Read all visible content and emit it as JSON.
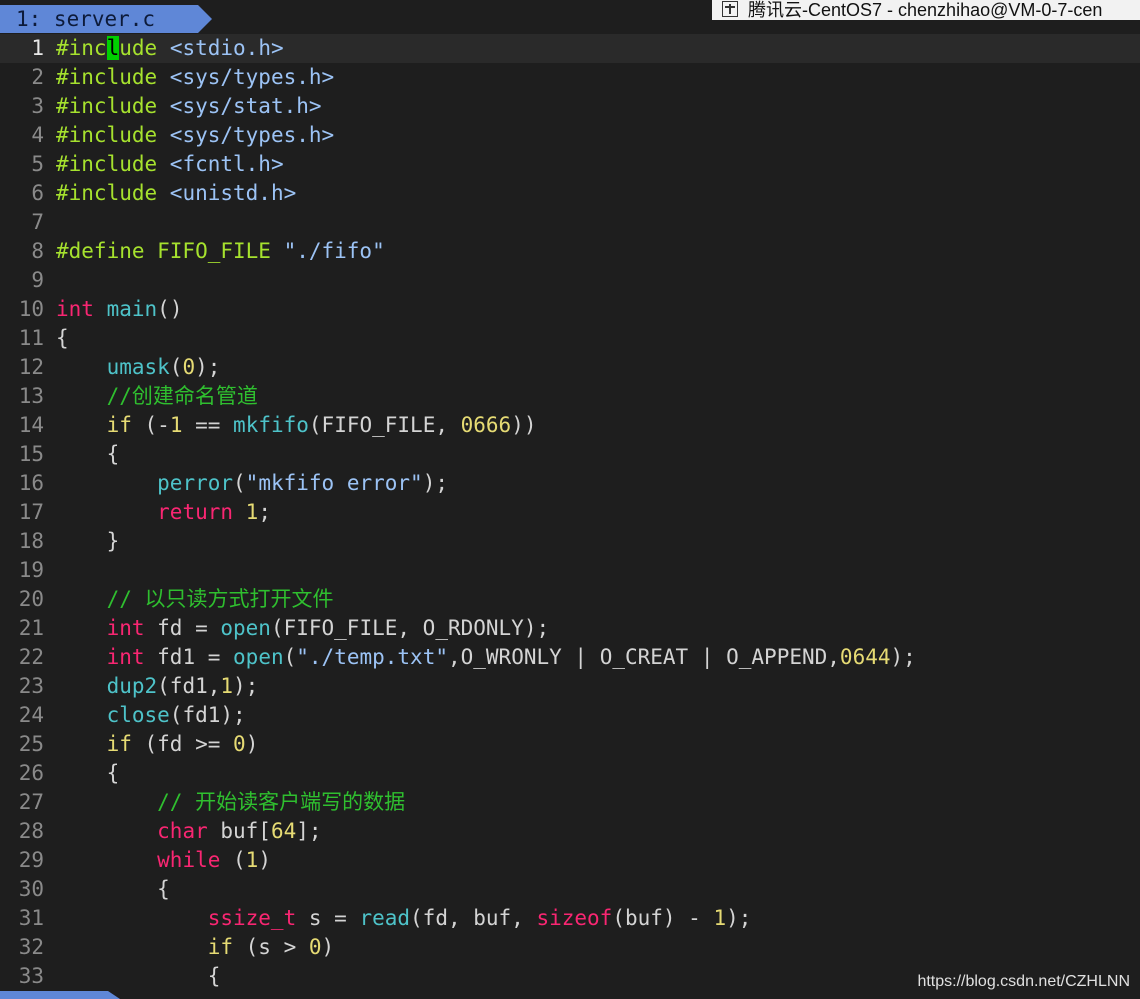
{
  "tab": {
    "label": "1: server.c"
  },
  "window_title": "腾讯云-CentOS7 - chenzhihao@VM-0-7-cen",
  "watermark": "https://blog.csdn.net/CZHLNN",
  "colors": {
    "tab": "#5f87d7",
    "cursor": "#00d000",
    "background": "#1e1e1e"
  },
  "cursor": {
    "line": 1,
    "column": 6
  },
  "lines": [
    {
      "n": "1",
      "tokens": [
        [
          "pp",
          "#inc"
        ],
        [
          "cursor",
          "l"
        ],
        [
          "pp",
          "ude "
        ],
        [
          "str",
          "<stdio.h>"
        ]
      ]
    },
    {
      "n": "2",
      "tokens": [
        [
          "pp",
          "#include "
        ],
        [
          "str",
          "<sys/types.h>"
        ]
      ]
    },
    {
      "n": "3",
      "tokens": [
        [
          "pp",
          "#include "
        ],
        [
          "str",
          "<sys/stat.h>"
        ]
      ]
    },
    {
      "n": "4",
      "tokens": [
        [
          "pp",
          "#include "
        ],
        [
          "str",
          "<sys/types.h>"
        ]
      ]
    },
    {
      "n": "5",
      "tokens": [
        [
          "pp",
          "#include "
        ],
        [
          "str",
          "<fcntl.h>"
        ]
      ]
    },
    {
      "n": "6",
      "tokens": [
        [
          "pp",
          "#include "
        ],
        [
          "str",
          "<unistd.h>"
        ]
      ]
    },
    {
      "n": "7",
      "tokens": []
    },
    {
      "n": "8",
      "tokens": [
        [
          "pp",
          "#define FIFO_FILE "
        ],
        [
          "str",
          "\"./fifo\""
        ]
      ]
    },
    {
      "n": "9",
      "tokens": []
    },
    {
      "n": "10",
      "tokens": [
        [
          "kw",
          "int"
        ],
        [
          "plain",
          " "
        ],
        [
          "fn",
          "main"
        ],
        [
          "plain",
          "()"
        ]
      ]
    },
    {
      "n": "11",
      "tokens": [
        [
          "plain",
          "{"
        ]
      ]
    },
    {
      "n": "12",
      "tokens": [
        [
          "plain",
          "    "
        ],
        [
          "fn",
          "umask"
        ],
        [
          "plain",
          "("
        ],
        [
          "num",
          "0"
        ],
        [
          "plain",
          ");"
        ]
      ]
    },
    {
      "n": "13",
      "tokens": [
        [
          "plain",
          "    "
        ],
        [
          "cm",
          "//创建命名管道"
        ]
      ]
    },
    {
      "n": "14",
      "tokens": [
        [
          "plain",
          "    "
        ],
        [
          "kw2",
          "if"
        ],
        [
          "plain",
          " (-"
        ],
        [
          "num",
          "1"
        ],
        [
          "plain",
          " == "
        ],
        [
          "fn",
          "mkfifo"
        ],
        [
          "plain",
          "(FIFO_FILE, "
        ],
        [
          "num",
          "0666"
        ],
        [
          "plain",
          "))"
        ]
      ]
    },
    {
      "n": "15",
      "tokens": [
        [
          "plain",
          "    {"
        ]
      ]
    },
    {
      "n": "16",
      "tokens": [
        [
          "plain",
          "        "
        ],
        [
          "fn",
          "perror"
        ],
        [
          "plain",
          "("
        ],
        [
          "str",
          "\"mkfifo error\""
        ],
        [
          "plain",
          ");"
        ]
      ]
    },
    {
      "n": "17",
      "tokens": [
        [
          "plain",
          "        "
        ],
        [
          "kw",
          "return"
        ],
        [
          "plain",
          " "
        ],
        [
          "num",
          "1"
        ],
        [
          "plain",
          ";"
        ]
      ]
    },
    {
      "n": "18",
      "tokens": [
        [
          "plain",
          "    }"
        ]
      ]
    },
    {
      "n": "19",
      "tokens": []
    },
    {
      "n": "20",
      "tokens": [
        [
          "plain",
          "    "
        ],
        [
          "cm",
          "// 以只读方式打开文件"
        ]
      ]
    },
    {
      "n": "21",
      "tokens": [
        [
          "plain",
          "    "
        ],
        [
          "kw",
          "int"
        ],
        [
          "plain",
          " fd = "
        ],
        [
          "fn",
          "open"
        ],
        [
          "plain",
          "(FIFO_FILE, O_RDONLY);"
        ]
      ]
    },
    {
      "n": "22",
      "tokens": [
        [
          "plain",
          "    "
        ],
        [
          "kw",
          "int"
        ],
        [
          "plain",
          " fd1 = "
        ],
        [
          "fn",
          "open"
        ],
        [
          "plain",
          "("
        ],
        [
          "str",
          "\"./temp.txt\""
        ],
        [
          "plain",
          ",O_WRONLY | O_CREAT | O_APPEND,"
        ],
        [
          "num",
          "0644"
        ],
        [
          "plain",
          ");"
        ]
      ]
    },
    {
      "n": "23",
      "tokens": [
        [
          "plain",
          "    "
        ],
        [
          "fn",
          "dup2"
        ],
        [
          "plain",
          "(fd1,"
        ],
        [
          "num",
          "1"
        ],
        [
          "plain",
          ");"
        ]
      ]
    },
    {
      "n": "24",
      "tokens": [
        [
          "plain",
          "    "
        ],
        [
          "fn",
          "close"
        ],
        [
          "plain",
          "(fd1);"
        ]
      ]
    },
    {
      "n": "25",
      "tokens": [
        [
          "plain",
          "    "
        ],
        [
          "kw2",
          "if"
        ],
        [
          "plain",
          " (fd >= "
        ],
        [
          "num",
          "0"
        ],
        [
          "plain",
          ")"
        ]
      ]
    },
    {
      "n": "26",
      "tokens": [
        [
          "plain",
          "    {"
        ]
      ]
    },
    {
      "n": "27",
      "tokens": [
        [
          "plain",
          "        "
        ],
        [
          "cm",
          "// 开始读客户端写的数据"
        ]
      ]
    },
    {
      "n": "28",
      "tokens": [
        [
          "plain",
          "        "
        ],
        [
          "kw",
          "char"
        ],
        [
          "plain",
          " buf["
        ],
        [
          "num",
          "64"
        ],
        [
          "plain",
          "];"
        ]
      ]
    },
    {
      "n": "29",
      "tokens": [
        [
          "plain",
          "        "
        ],
        [
          "kw",
          "while"
        ],
        [
          "plain",
          " ("
        ],
        [
          "num",
          "1"
        ],
        [
          "plain",
          ")"
        ]
      ]
    },
    {
      "n": "30",
      "tokens": [
        [
          "plain",
          "        {"
        ]
      ]
    },
    {
      "n": "31",
      "tokens": [
        [
          "plain",
          "            "
        ],
        [
          "kw",
          "ssize_t"
        ],
        [
          "plain",
          " s = "
        ],
        [
          "fn",
          "read"
        ],
        [
          "plain",
          "(fd, buf, "
        ],
        [
          "kw",
          "sizeof"
        ],
        [
          "plain",
          "(buf) - "
        ],
        [
          "num",
          "1"
        ],
        [
          "plain",
          ");"
        ]
      ]
    },
    {
      "n": "32",
      "tokens": [
        [
          "plain",
          "            "
        ],
        [
          "kw2",
          "if"
        ],
        [
          "plain",
          " (s > "
        ],
        [
          "num",
          "0"
        ],
        [
          "plain",
          ")"
        ]
      ]
    },
    {
      "n": "33",
      "tokens": [
        [
          "plain",
          "            {"
        ]
      ]
    }
  ]
}
